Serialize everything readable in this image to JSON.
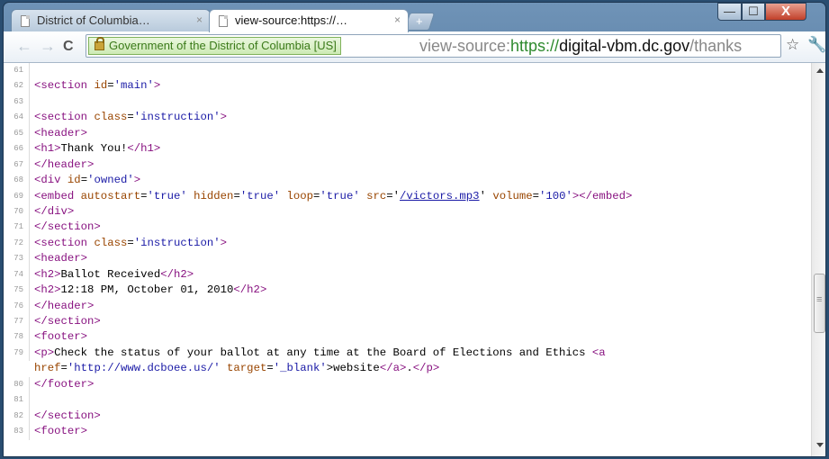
{
  "tabs": [
    {
      "title": "District of Columbia…",
      "close": "×"
    },
    {
      "title": "view-source:https://…",
      "close": "×"
    }
  ],
  "newtab": "+",
  "window_buttons": {
    "minimize": "—",
    "maximize": "☐",
    "close": "X"
  },
  "nav": {
    "back": "←",
    "forward": "→",
    "reload": "C"
  },
  "omnibox": {
    "ev_label": "Government of the District of Columbia [US]",
    "url_scheme": "view-source:",
    "url_https": "https://",
    "url_host": "digital-vbm.dc.gov",
    "url_path": "/thanks"
  },
  "icons": {
    "star": "☆",
    "wrench": "🔧"
  },
  "source_lines": [
    {
      "n": "61",
      "text": ""
    },
    {
      "n": "62",
      "text": "<section id='main'>"
    },
    {
      "n": "63",
      "text": ""
    },
    {
      "n": "64",
      "text": "<section class='instruction'>"
    },
    {
      "n": "65",
      "text": "<header>"
    },
    {
      "n": "66",
      "text": "<h1>Thank You!</h1>"
    },
    {
      "n": "67",
      "text": "</header>"
    },
    {
      "n": "68",
      "text": "<div id='owned'>"
    },
    {
      "n": "69",
      "text": "<embed autostart='true' hidden='true' loop='true' src='/victors.mp3' volume='100'></embed>"
    },
    {
      "n": "70",
      "text": "</div>"
    },
    {
      "n": "71",
      "text": "</section>"
    },
    {
      "n": "72",
      "text": "<section class='instruction'>"
    },
    {
      "n": "73",
      "text": "<header>"
    },
    {
      "n": "74",
      "text": "<h2>Ballot Received</h2>"
    },
    {
      "n": "75",
      "text": "<h2>12:18 PM, October 01, 2010</h2>"
    },
    {
      "n": "76",
      "text": "</header>"
    },
    {
      "n": "77",
      "text": "</section>"
    },
    {
      "n": "78",
      "text": "<footer>"
    },
    {
      "n": "79",
      "text": "<p>Check the status of your ballot at any time at the Board of Elections and Ethics <a"
    },
    {
      "n": "",
      "text": "href='http://www.dcboee.us/' target='_blank'>website</a>.</p>"
    },
    {
      "n": "80",
      "text": "</footer>"
    },
    {
      "n": "81",
      "text": ""
    },
    {
      "n": "82",
      "text": "</section>"
    },
    {
      "n": "83",
      "text": "<footer>"
    }
  ]
}
